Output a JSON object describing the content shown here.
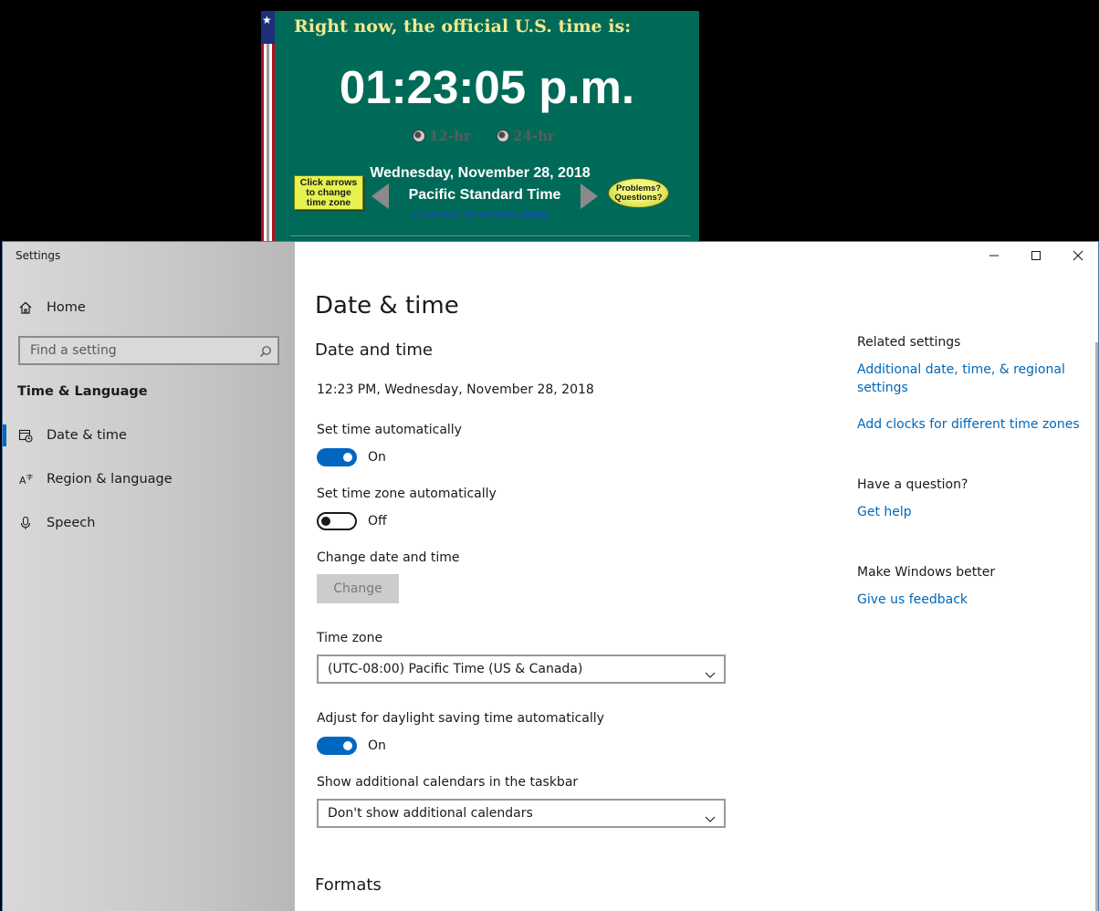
{
  "timegov": {
    "heading": "Right now, the official U.S. time is:",
    "clock": "01:23:05 p.m.",
    "radio_12": "12-hr",
    "radio_24": "24-hr",
    "click_arrows": "Click arrows to change time zone",
    "date": "Wednesday, November 28, 2018",
    "zone": "Pacific Standard Time",
    "corrected": "Corrected for network delay",
    "problems": "Problems? Questions?"
  },
  "window": {
    "app_title": "Settings"
  },
  "sidebar": {
    "home": "Home",
    "search_placeholder": "Find a setting",
    "section": "Time & Language",
    "items": [
      {
        "label": "Date & time",
        "icon": "date-time-icon",
        "active": true
      },
      {
        "label": "Region & language",
        "icon": "region-language-icon",
        "active": false
      },
      {
        "label": "Speech",
        "icon": "microphone-icon",
        "active": false
      }
    ]
  },
  "main": {
    "title": "Date & time",
    "group_heading": "Date and time",
    "current_time": "12:23 PM, Wednesday, November 28, 2018",
    "set_time_label": "Set time automatically",
    "set_time_state": "On",
    "set_zone_label": "Set time zone automatically",
    "set_zone_state": "Off",
    "change_label": "Change date and time",
    "change_button": "Change",
    "timezone_label": "Time zone",
    "timezone_value": "(UTC-08:00) Pacific Time (US & Canada)",
    "dst_label": "Adjust for daylight saving time automatically",
    "dst_state": "On",
    "calendars_label": "Show additional calendars in the taskbar",
    "calendars_value": "Don't show additional calendars",
    "formats_heading": "Formats"
  },
  "related": {
    "related_head": "Related settings",
    "link_regional": "Additional date, time, & regional settings",
    "link_clocks": "Add clocks for different time zones",
    "question_head": "Have a question?",
    "link_help": "Get help",
    "better_head": "Make Windows better",
    "link_feedback": "Give us feedback"
  },
  "colors": {
    "accent": "#0067c0",
    "link": "#0067b8",
    "timegov_bg": "#006a58"
  }
}
